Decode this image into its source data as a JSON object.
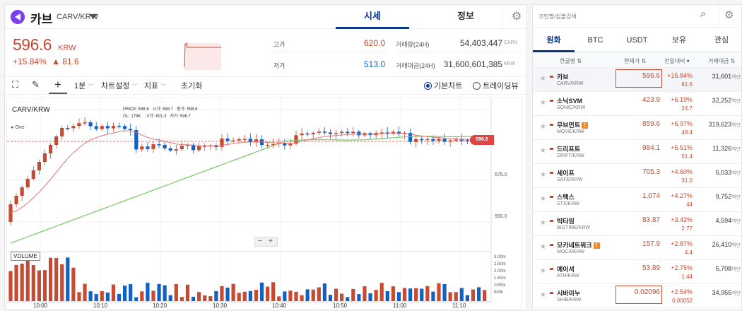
{
  "header": {
    "coin_name": "카브",
    "pair": "CARV/KRW",
    "tab_quote": "시세",
    "tab_info": "정보"
  },
  "price": {
    "current": "596.6",
    "unit": "KRW",
    "change_pct": "+15.84%",
    "change_abs": "▲ 81.6"
  },
  "stats": {
    "high_label": "고가",
    "high": "620.0",
    "low_label": "저가",
    "low": "513.0",
    "vol_label": "거래량(24H)",
    "vol": "54,403,447",
    "vol_unit": "CARV",
    "amt_label": "거래대금(24H)",
    "amt": "31,600,601,385",
    "amt_unit": "KRW"
  },
  "toolbar": {
    "interval": "1분",
    "chart_settings": "차트설정",
    "indicators": "지표",
    "reset": "초기화",
    "basic_chart": "기본차트",
    "trading_view": "트레이딩뷰"
  },
  "chart": {
    "symbol": "CARV/KRW",
    "legend_label": "Ove",
    "ohlc_price": "PRICE: 598.8",
    "ohlc_open": "시가: 598.7",
    "ohlc_close": "종가: 598.8",
    "ohlc_vol": "OL: 179K",
    "ohlc_high": "고가: 601.3",
    "ohlc_low": "저가: 596.7",
    "price_tag": "596.6",
    "price_ticks": [
      "575.0",
      "550.0"
    ],
    "volume_label": "VOLUME",
    "vol_ticks": [
      "3.00m",
      "2.50m",
      "2.00m",
      "1.50m",
      "1000k",
      "500k"
    ],
    "time_ticks": [
      "10:00",
      "10:10",
      "10:20",
      "10:30",
      "10:40",
      "10:50",
      "11:00",
      "11:10"
    ],
    "zoom_out": "−",
    "zoom_in": "+"
  },
  "market": {
    "search_placeholder": "코인명/심볼검색",
    "tabs": [
      "원화",
      "BTC",
      "USDT",
      "보유",
      "관심"
    ],
    "columns": [
      "한글명",
      "현재가",
      "전일대비",
      "거래대금"
    ],
    "rows": [
      {
        "name": "카브",
        "pair": "CARV/KRW",
        "price": "596.6",
        "pct": "+15.84%",
        "abs": "81.6",
        "vol": "31,601",
        "unit": "백만",
        "warn": false
      },
      {
        "name": "소닉SVM",
        "pair": "SONIC/KRW",
        "price": "423.9",
        "pct": "+6.19%",
        "abs": "24.7",
        "vol": "32,252",
        "unit": "백만",
        "warn": false
      },
      {
        "name": "무브먼트",
        "pair": "MOVE/KRW",
        "price": "859.6",
        "pct": "+5.97%",
        "abs": "48.4",
        "vol": "319,623",
        "unit": "백만",
        "warn": true
      },
      {
        "name": "드리프트",
        "pair": "DRIFT/KRW",
        "price": "984.1",
        "pct": "+5.51%",
        "abs": "51.4",
        "vol": "11,326",
        "unit": "백만",
        "warn": false
      },
      {
        "name": "세이프",
        "pair": "SAFE/KRW",
        "price": "705.3",
        "pct": "+4.60%",
        "abs": "31.0",
        "vol": "5,033",
        "unit": "백만",
        "warn": false
      },
      {
        "name": "스택스",
        "pair": "STX/KRW",
        "price": "1,074",
        "pct": "+4.27%",
        "abs": "44",
        "vol": "9,752",
        "unit": "백만",
        "warn": false
      },
      {
        "name": "빅타임",
        "pair": "BIGTIME/KRW",
        "price": "83.87",
        "pct": "+3.42%",
        "abs": "2.77",
        "vol": "4,594",
        "unit": "백만",
        "warn": false
      },
      {
        "name": "모카네트워크",
        "pair": "MOCA/KRW",
        "price": "157.9",
        "pct": "+2.87%",
        "abs": "4.4",
        "vol": "26,410",
        "unit": "백만",
        "warn": true
      },
      {
        "name": "에이셔",
        "pair": "ATH/KRW",
        "price": "53.89",
        "pct": "+2.75%",
        "abs": "1.44",
        "vol": "5,708",
        "unit": "백만",
        "warn": false
      },
      {
        "name": "시바이누",
        "pair": "SHIB/KRW",
        "price": "0.02096",
        "pct": "+2.54%",
        "abs": "0.00052",
        "vol": "34,955",
        "unit": "백만",
        "warn": false
      }
    ]
  },
  "colors": {
    "up": "#c84a31",
    "down": "#1261c4",
    "accent": "#093687",
    "ma_red": "#e57373",
    "ma_green": "#7cc96b"
  }
}
